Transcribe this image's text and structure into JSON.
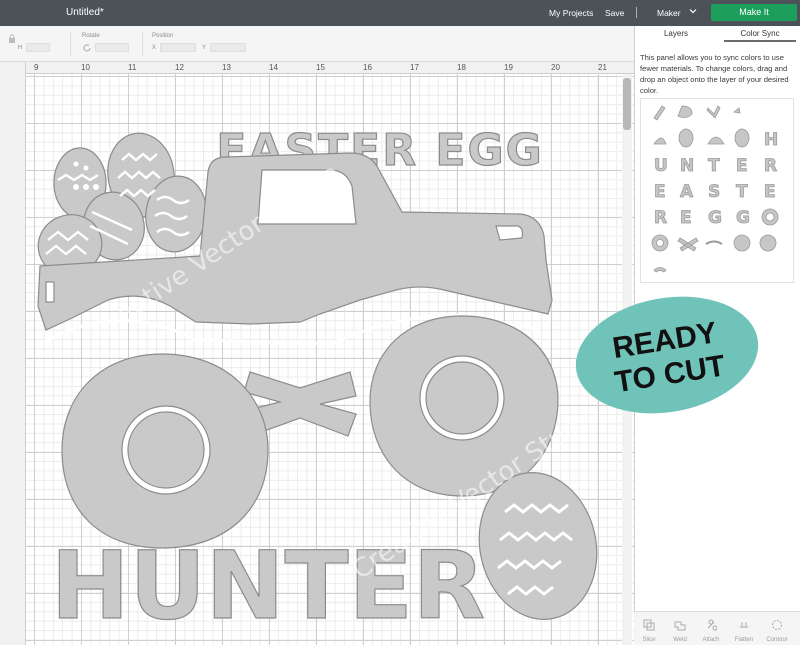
{
  "topbar": {
    "doc_title": "Untitled*",
    "my_projects": "My Projects",
    "save": "Save",
    "separator": "|",
    "machine": "Maker",
    "make_it": "Make It",
    "make_it_color": "#1c9f5b"
  },
  "toolbar": {
    "size_label": "H",
    "rotate_label": "Rotate",
    "position_label": "Position",
    "x_label": "X",
    "y_label": "Y"
  },
  "ruler": {
    "numbers": [
      "9",
      "10",
      "11",
      "12",
      "13",
      "14",
      "15",
      "16",
      "17",
      "18",
      "19",
      "20",
      "21"
    ]
  },
  "panel": {
    "tabs": [
      "Layers",
      "Color Sync"
    ],
    "active_tab": "Color Sync",
    "description": "This panel allows you to sync colors to use fewer materials. To change colors, drag and drop an object onto the layer of your desired color.",
    "tools": [
      "Slice",
      "Weld",
      "Attach",
      "Flatten",
      "Contour"
    ]
  },
  "design": {
    "headline": "EASTER EGG",
    "bottom_word": "HUNTER",
    "watermark": "Creative Vector Studio",
    "shape_color": "#c9c9c9"
  },
  "badge": {
    "line1": "READY",
    "line2": "TO CUT",
    "color": "#6fc3b8"
  }
}
